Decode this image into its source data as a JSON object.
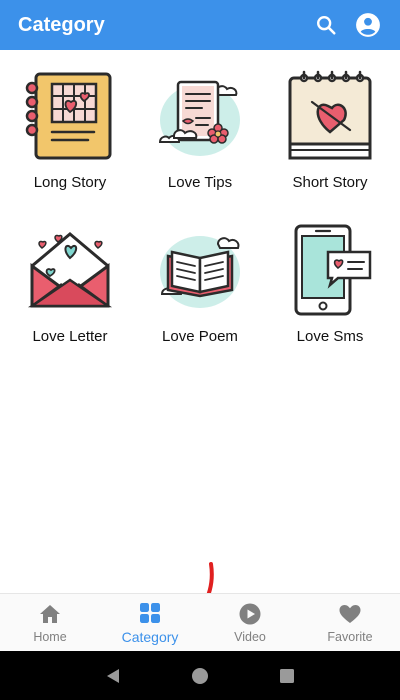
{
  "appbar": {
    "title": "Category",
    "search_icon": "search-icon",
    "account_icon": "account-circle-icon",
    "color": "#3c91ea"
  },
  "categories": [
    {
      "label": "Long Story",
      "icon": "notebook-hearts-icon"
    },
    {
      "label": "Love Tips",
      "icon": "love-note-icon"
    },
    {
      "label": "Short Story",
      "icon": "calendar-heart-icon"
    },
    {
      "label": "Love Letter",
      "icon": "envelope-hearts-icon"
    },
    {
      "label": "Love Poem",
      "icon": "open-book-icon"
    },
    {
      "label": "Love Sms",
      "icon": "phone-message-icon"
    }
  ],
  "bottom_nav": {
    "items": [
      {
        "label": "Home",
        "icon": "home-icon",
        "active": false
      },
      {
        "label": "Category",
        "icon": "grid-icon",
        "active": true
      },
      {
        "label": "Video",
        "icon": "play-circle-icon",
        "active": false
      },
      {
        "label": "Favorite",
        "icon": "heart-icon",
        "active": false
      }
    ],
    "active_color": "#3c91ea",
    "inactive_color": "#808080"
  },
  "system_nav": {
    "buttons": [
      "back-icon",
      "home-circle-icon",
      "recents-square-icon"
    ]
  }
}
